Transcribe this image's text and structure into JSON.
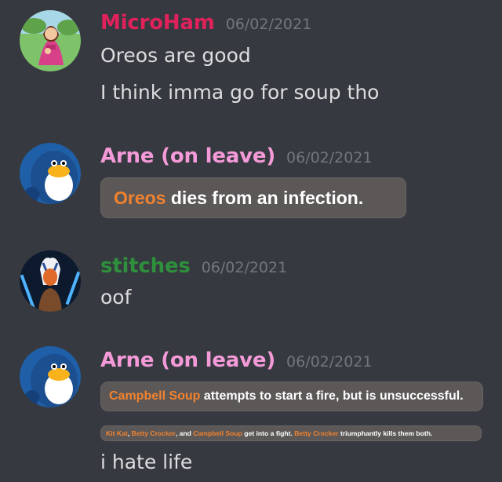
{
  "colors": {
    "background": "#36393f",
    "text": "#dcddde",
    "timestamp": "#72767d",
    "microham": "#e0215c",
    "arne": "#f49ad8",
    "stitches": "#2e8f3c",
    "highlight": "#f2822d"
  },
  "messages": [
    {
      "author": "MicroHam",
      "timestamp": "06/02/2021",
      "avatar_icon": "pink-dress-character-avatar",
      "lines": [
        "Oreos are good",
        "I think imma go for soup tho"
      ]
    },
    {
      "author": "Arne (on leave)",
      "timestamp": "06/02/2021",
      "avatar_icon": "blue-penguin-avatar",
      "event": {
        "name": "Oreos",
        "text": " dies from an infection."
      }
    },
    {
      "author": "stitches",
      "timestamp": "06/02/2021",
      "avatar_icon": "ahsoka-avatar",
      "lines": [
        "oof"
      ]
    },
    {
      "author": "Arne (on leave)",
      "timestamp": "06/02/2021",
      "avatar_icon": "blue-penguin-avatar",
      "event1": {
        "name": "Campbell Soup",
        "text": " attempts to start a fire, but is unsuccessful."
      },
      "event2": {
        "name1": "Kit Kat",
        "sep1": ", ",
        "name2": "Betty Crocker",
        "sep2": ", and ",
        "name3": "Campbell Soup",
        "text1": " get into a fight. ",
        "name4": "Betty Crocker",
        "text2": " triumphantly kills them both."
      },
      "lines": [
        "i hate life"
      ]
    }
  ]
}
